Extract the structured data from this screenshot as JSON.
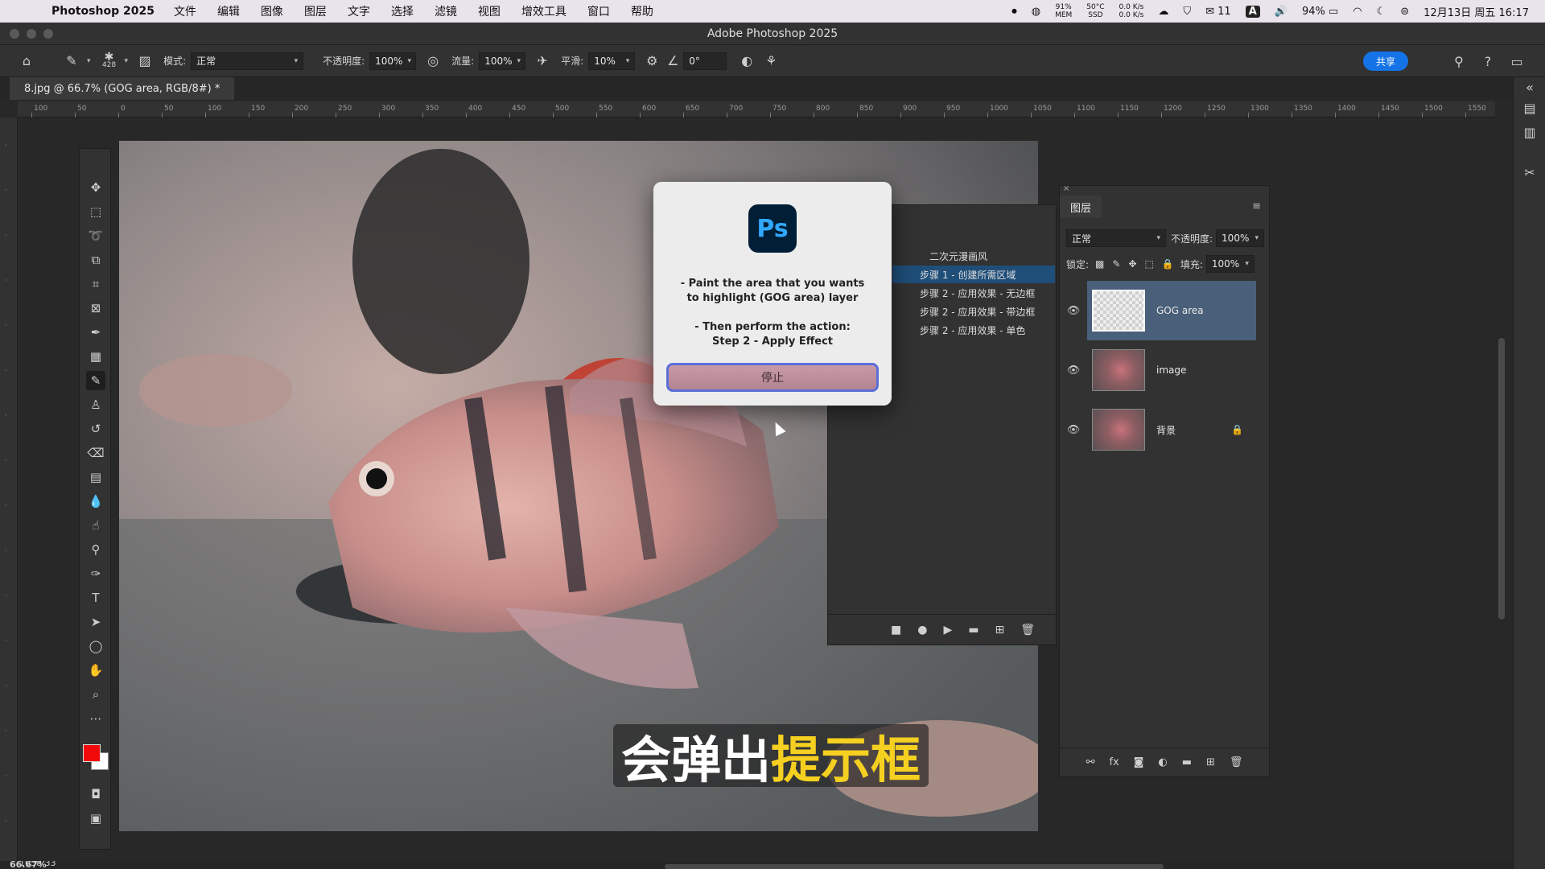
{
  "menubar": {
    "app_name": "Photoshop 2025",
    "items": [
      "文件",
      "编辑",
      "图像",
      "图层",
      "文字",
      "选择",
      "滤镜",
      "视图",
      "增效工具",
      "窗口",
      "帮助"
    ],
    "cpu_percent": "91%",
    "cpu_label": "MEM",
    "temp": "50°C",
    "temp_label": "SSD",
    "net_up": "0.0 K/s",
    "net_down": "0.0 K/s",
    "wechat_count": "11",
    "input_method": "A",
    "battery": "94%",
    "datetime": "12月13日 周五 16:17"
  },
  "window": {
    "title": "Adobe Photoshop 2025"
  },
  "options_bar": {
    "brush_size": "428",
    "mode_label": "模式:",
    "mode_value": "正常",
    "opacity_label": "不透明度:",
    "opacity_value": "100%",
    "flow_label": "流量:",
    "flow_value": "100%",
    "smoothing_label": "平滑:",
    "smoothing_value": "10%",
    "angle_value": "0°",
    "share_label": "共享"
  },
  "document": {
    "tab_title": "8.jpg @ 66.7% (GOG area, RGB/8#) *"
  },
  "ruler_top_labels": [
    "100",
    "50",
    "0",
    "50",
    "100",
    "150",
    "200",
    "250",
    "300",
    "350",
    "400",
    "450",
    "500",
    "550",
    "600",
    "650",
    "700",
    "750",
    "800",
    "850",
    "900",
    "950",
    "1000",
    "1050",
    "1100",
    "1150",
    "1200",
    "1250",
    "1300",
    "1350",
    "1400",
    "1450",
    "1500",
    "1550"
  ],
  "actions_panel": {
    "set_name": "二次元漫画风",
    "items": [
      "步骤 1 - 创建所需区域",
      "步骤 2 - 应用效果 - 无边框",
      "步骤 2 - 应用效果 - 带边框",
      "步骤 2 - 应用效果 - 单色"
    ]
  },
  "layers_panel": {
    "tab_label": "图层",
    "blend_mode": "正常",
    "opacity_label": "不透明度:",
    "opacity_value": "100%",
    "lock_label": "锁定:",
    "fill_label": "填充:",
    "fill_value": "100%",
    "layers": [
      {
        "name": "GOG area",
        "selected": true,
        "locked": false
      },
      {
        "name": "image",
        "selected": false,
        "locked": false
      },
      {
        "name": "背景",
        "selected": false,
        "locked": true
      }
    ]
  },
  "dialog": {
    "logo_text": "Ps",
    "line1": "- Paint the area that you wants",
    "line2": "to highlight (GOG area) layer",
    "line3": "- Then perform the action:",
    "line4": "Step 2 - Apply Effect",
    "stop_button": "停止"
  },
  "subtitle": {
    "normal": "会弹出",
    "highlight": "提示框"
  },
  "status_bar": {
    "zoom": "66.67%",
    "doc_size": "1058.33 mm x 793.4 mm (72 ppi)"
  },
  "colors": {
    "foreground": "#f20a0a",
    "background": "#ffffff",
    "accent": "#1473e6",
    "selection": "#4a5f7a"
  }
}
